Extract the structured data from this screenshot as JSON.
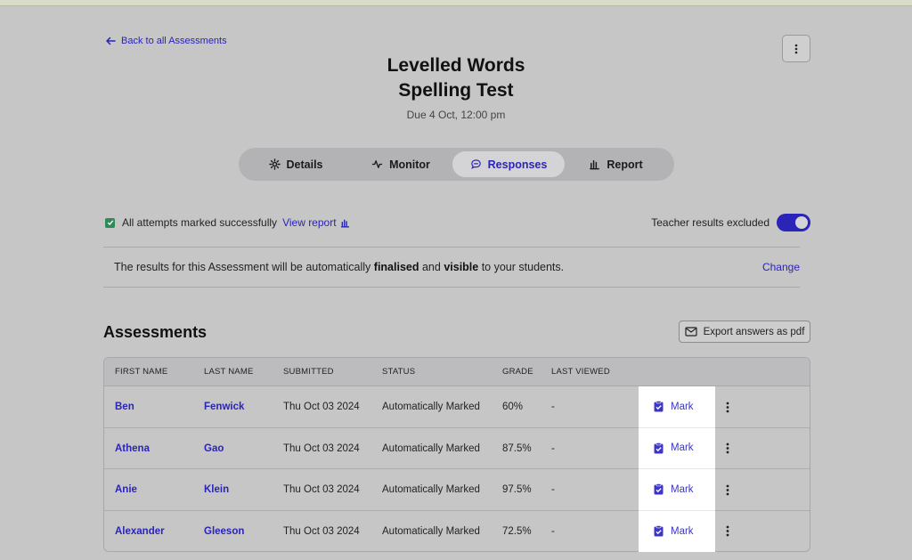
{
  "back_link": {
    "label": "Back to all Assessments",
    "icon": "arrow-left-icon"
  },
  "title_line1": "Levelled Words",
  "title_line2": "Spelling Test",
  "due": "Due 4 Oct, 12:00 pm",
  "tabs": [
    {
      "label": "Details",
      "icon": "gear-icon",
      "active": false
    },
    {
      "label": "Monitor",
      "icon": "pulse-icon",
      "active": false
    },
    {
      "label": "Responses",
      "icon": "chat-icon",
      "active": true
    },
    {
      "label": "Report",
      "icon": "bar-chart-icon",
      "active": false
    }
  ],
  "status": {
    "text": "All attempts marked successfully",
    "view_report": "View report",
    "toggle_label": "Teacher results excluded",
    "toggle_on": true
  },
  "notice": {
    "prefix": "The results for this Assessment will be automatically ",
    "bold1": "finalised",
    "middle": " and ",
    "bold2": "visible",
    "suffix": " to your students.",
    "change": "Change"
  },
  "section_title": "Assessments",
  "export_label": "Export answers as pdf",
  "table": {
    "headers": [
      "FIRST NAME",
      "LAST NAME",
      "SUBMITTED",
      "STATUS",
      "GRADE",
      "LAST VIEWED"
    ],
    "rows": [
      {
        "first": "Ben",
        "last": "Fenwick",
        "submitted": "Thu Oct 03 2024",
        "status": "Automatically Marked",
        "grade": "60%",
        "viewed": "-"
      },
      {
        "first": "Athena",
        "last": "Gao",
        "submitted": "Thu Oct 03 2024",
        "status": "Automatically Marked",
        "grade": "87.5%",
        "viewed": "-"
      },
      {
        "first": "Anie",
        "last": "Klein",
        "submitted": "Thu Oct 03 2024",
        "status": "Automatically Marked",
        "grade": "97.5%",
        "viewed": "-"
      },
      {
        "first": "Alexander",
        "last": "Gleeson",
        "submitted": "Thu Oct 03 2024",
        "status": "Automatically Marked",
        "grade": "72.5%",
        "viewed": "-"
      }
    ],
    "mark_label": "Mark"
  },
  "colors": {
    "accent": "#2a24b8",
    "check": "#2e8b57",
    "mark": "#3c35c9"
  }
}
